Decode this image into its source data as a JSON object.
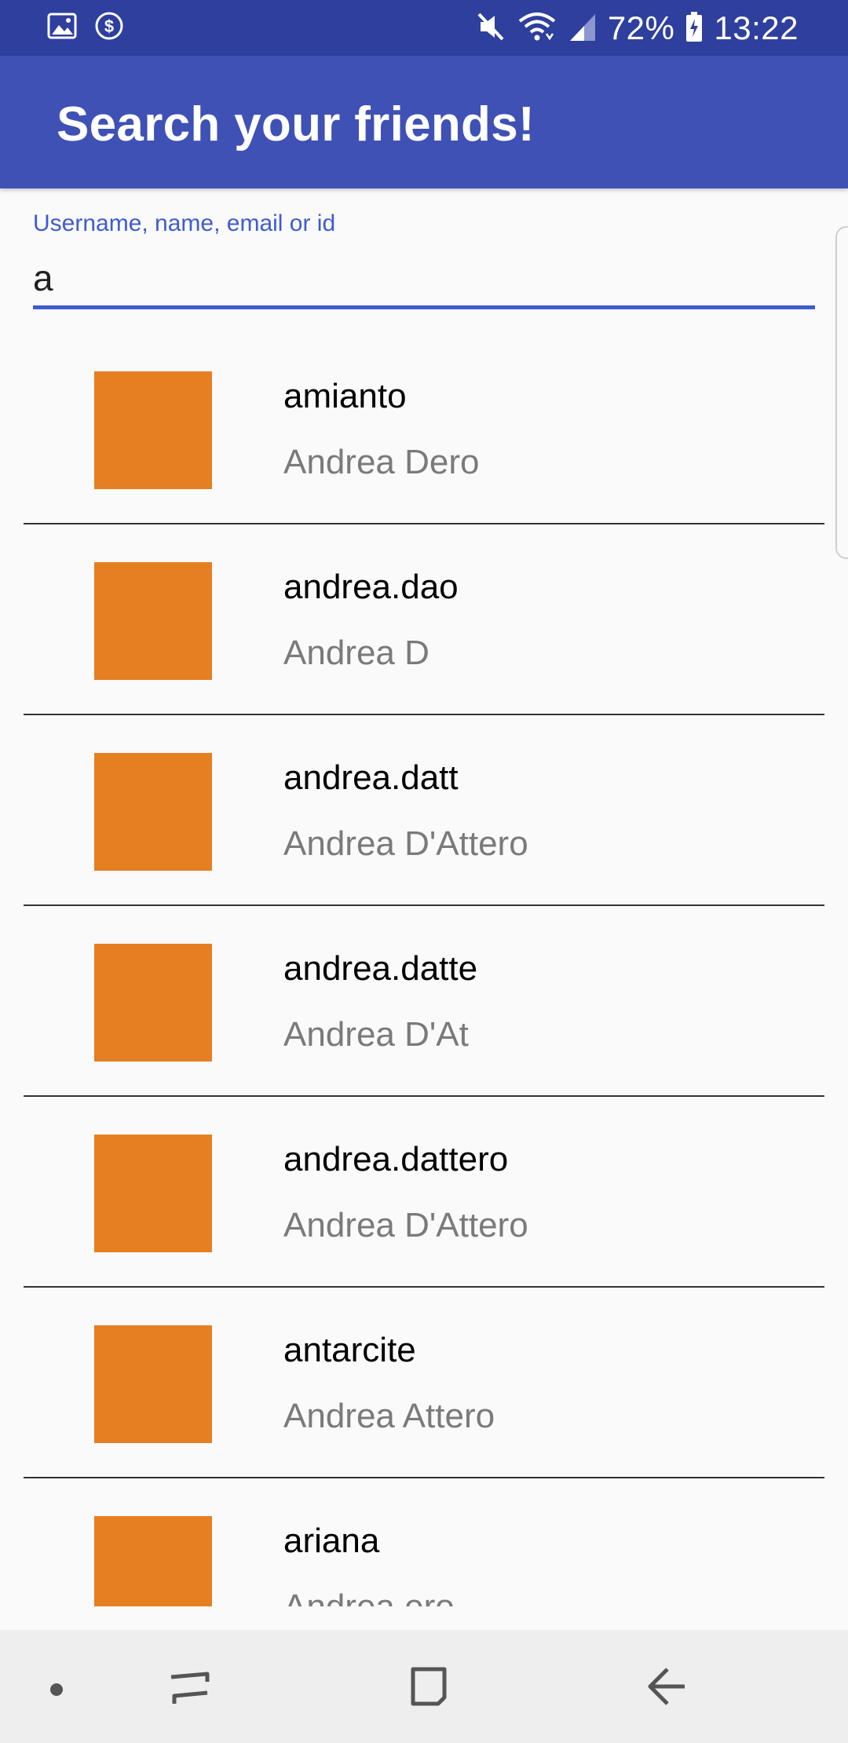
{
  "status_bar": {
    "battery": "72%",
    "time": "13:22",
    "icons": [
      "image-icon",
      "dollar-circle-icon",
      "mute-icon",
      "wifi-icon",
      "signal-icon",
      "battery-charging-icon"
    ]
  },
  "app_bar": {
    "title": "Search your friends!"
  },
  "search": {
    "label": "Username, name, email or id",
    "value": "a"
  },
  "results": [
    {
      "username": "amianto",
      "fullname": "Andrea Dero"
    },
    {
      "username": "andrea.dao",
      "fullname": "Andrea D"
    },
    {
      "username": "andrea.datt",
      "fullname": "Andrea D'Attero"
    },
    {
      "username": "andrea.datte",
      "fullname": "Andrea D'At"
    },
    {
      "username": "andrea.dattero",
      "fullname": "Andrea D'Attero"
    },
    {
      "username": "antarcite",
      "fullname": "Andrea Attero"
    },
    {
      "username": "ariana",
      "fullname": "Andrea ero"
    }
  ],
  "nav_bar": {
    "icons": [
      "dot-icon",
      "recent-apps-icon",
      "home-icon",
      "back-icon"
    ]
  },
  "colors": {
    "status_bar": "#2f3f9e",
    "app_bar": "#3f51b5",
    "accent": "#3f5bd1",
    "avatar": "#e67f22",
    "background": "#fafafa"
  }
}
